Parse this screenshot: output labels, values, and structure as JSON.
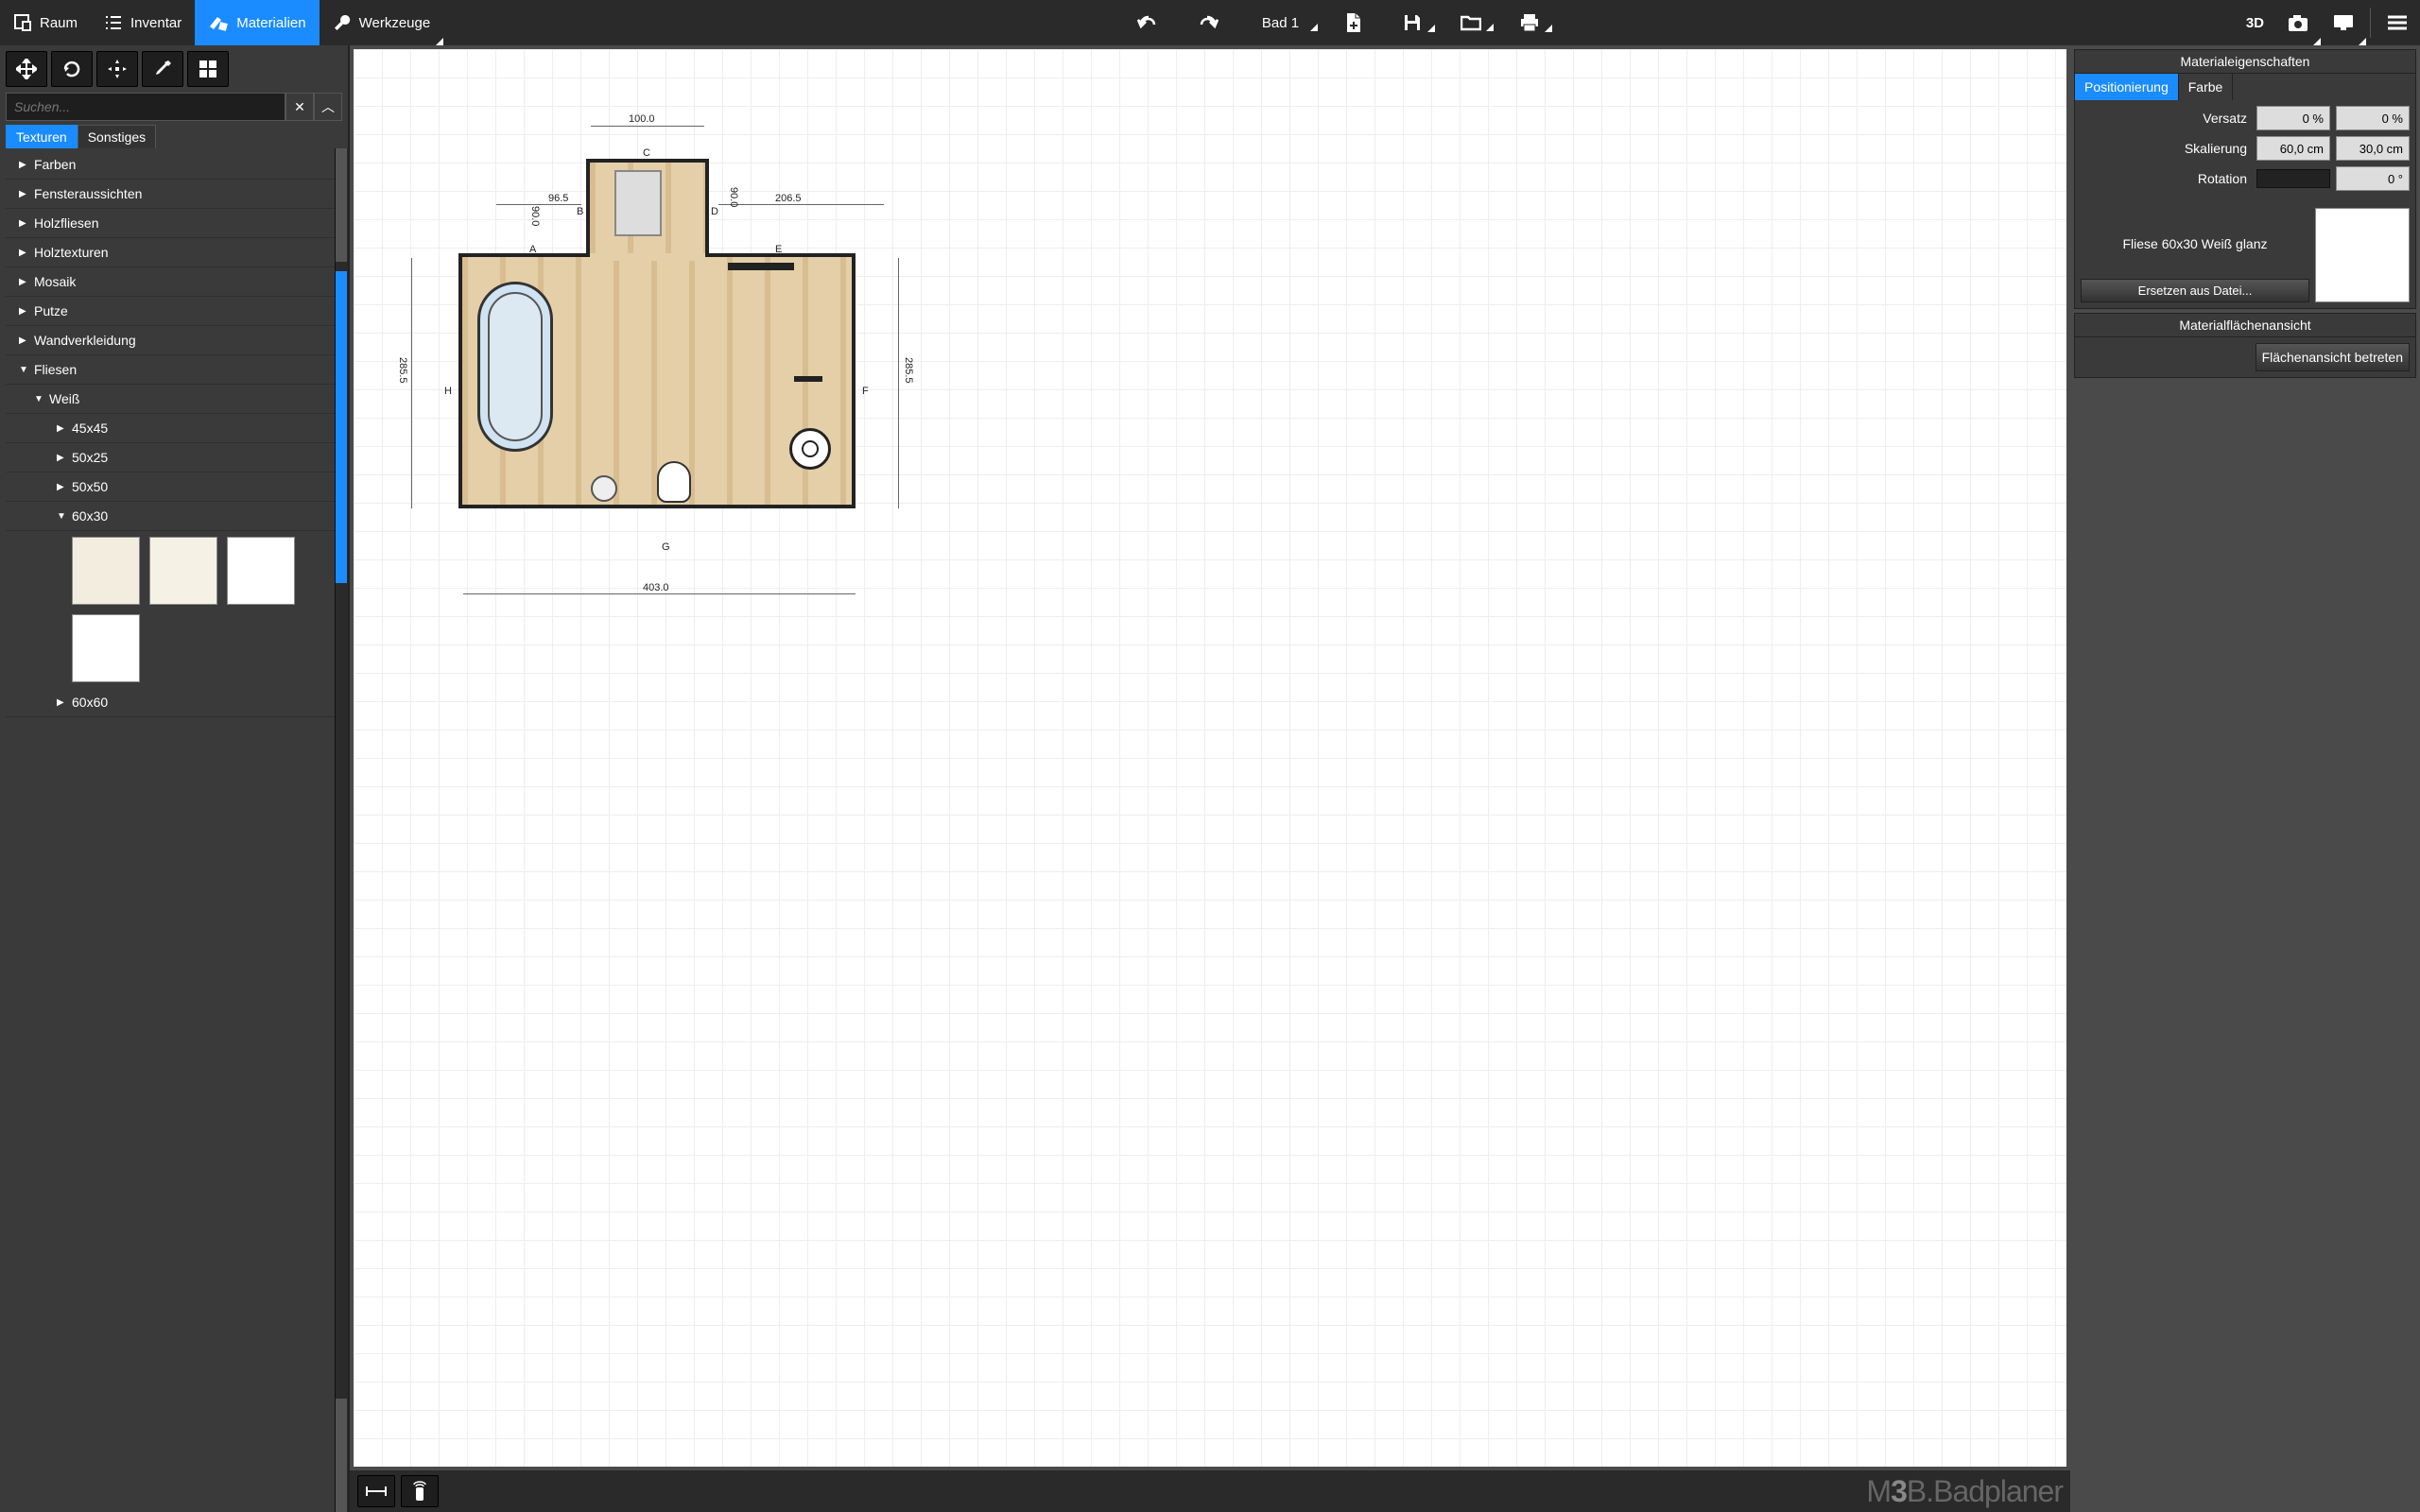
{
  "topbar": {
    "room": "Raum",
    "inventory": "Inventar",
    "materials": "Materialien",
    "tools": "Werkzeuge",
    "doc_title": "Bad 1",
    "view3d": "3D"
  },
  "toolbox": {
    "search_placeholder": "Suchen...",
    "tabs": {
      "textures": "Texturen",
      "other": "Sonstiges"
    }
  },
  "tree": {
    "farben": "Farben",
    "fensteraussichten": "Fensteraussichten",
    "holzfliesen": "Holzfliesen",
    "holztexturen": "Holztexturen",
    "mosaik": "Mosaik",
    "putze": "Putze",
    "wandverkleidung": "Wandverkleidung",
    "fliesen": "Fliesen",
    "weiss": "Weiß",
    "s45x45": "45x45",
    "s50x25": "50x25",
    "s50x50": "50x50",
    "s60x30": "60x30",
    "s60x60": "60x60"
  },
  "props": {
    "header": "Materialeigenschaften",
    "tab_pos": "Positionierung",
    "tab_color": "Farbe",
    "versatz": "Versatz",
    "versatz_v1": "0 %",
    "versatz_v2": "0 %",
    "skalierung": "Skalierung",
    "skalierung_v1": "60,0 cm",
    "skalierung_v2": "30,0 cm",
    "rotation": "Rotation",
    "rotation_v": "0 °",
    "material_name": "Fliese 60x30 Weiß glanz",
    "replace": "Ersetzen aus Datei..."
  },
  "surface_panel": {
    "header": "Materialflächenansicht",
    "button": "Flächenansicht betreten"
  },
  "branding": {
    "m": "M",
    "three": "3",
    "rest": "B.Badplaner"
  },
  "plan": {
    "dim_top": "100.0",
    "dim_top_left": "96.5",
    "dim_left_upper": "90.0",
    "dim_right_upper": "90.0",
    "dim_right_top": "206.5",
    "dim_left": "285.5",
    "dim_right": "285.5",
    "dim_bottom": "403.0",
    "A": "A",
    "B": "B",
    "C": "C",
    "D": "D",
    "E": "E",
    "F": "F",
    "G": "G",
    "H": "H"
  }
}
